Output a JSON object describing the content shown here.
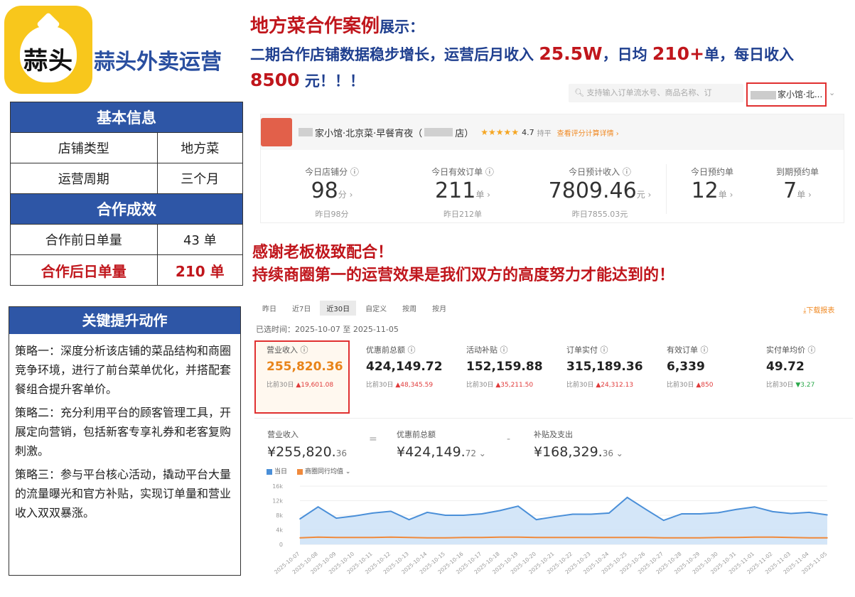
{
  "brand": {
    "logo_text": "蒜头",
    "name": "蒜头外卖运营"
  },
  "headline": {
    "title": "地方菜合作案例",
    "title_suffix": "展示：",
    "line_a": "二期合作店铺数据稳步增长，运营后月收入 ",
    "v1": "25.5W",
    "line_b": "，日均 ",
    "v2": "210+",
    "line_c": "单，每日收入 ",
    "v3": "8500",
    "line_d": " 元！！！"
  },
  "basic_info": {
    "header": "基本信息",
    "rows": [
      {
        "k": "店铺类型",
        "v": "地方菜"
      },
      {
        "k": "运营周期",
        "v": "三个月"
      }
    ],
    "result_header": "合作成效",
    "before": {
      "k": "合作前日单量",
      "v": "43 单"
    },
    "after": {
      "k": "合作后日单量",
      "v": "210 单"
    }
  },
  "key_actions": {
    "header": "关键提升动作",
    "items": [
      "策略一：深度分析该店铺的菜品结构和商圈竞争环境，进行了前台菜单优化，并搭配套餐组合提升客单价。",
      "策略二：充分利用平台的顾客管理工具，开展定向营销，包括新客专享礼券和老客复购刺激。",
      "策略三：参与平台核心活动，撬动平台大量的流量曝光和官方补贴，实现订单量和营业收入双双暴涨。"
    ]
  },
  "thanks": {
    "line1": "感谢老板极致配合！",
    "line2": "持续商圈第一的运营效果是我们双方的高度努力才能达到的！"
  },
  "screen1": {
    "search_placeholder": "支持输入订单流水号、商品名称、订",
    "store_selector": "家小馆·北...",
    "store_name": "家小馆·北京菜·早餐宵夜（",
    "store_suffix": "店）",
    "rating": "4.7",
    "rating_level": "持平",
    "rating_link": "查看评分计算详情 ›",
    "metrics": [
      {
        "label": "今日店铺分 ⓘ",
        "value": "98",
        "unit": "分 ›",
        "sub": "昨日98分"
      },
      {
        "label": "今日有效订单 ⓘ",
        "value": "211",
        "unit": "单 ›",
        "sub": "昨日212单"
      },
      {
        "label": "今日预计收入 ⓘ",
        "value": "7809.46",
        "unit": "元 ›",
        "sub": "昨日7855.03元"
      },
      {
        "label": "今日预约单",
        "value": "12",
        "unit": "单 ›",
        "sub": ""
      },
      {
        "label": "到期预约单",
        "value": "7",
        "unit": "单 ›",
        "sub": ""
      }
    ]
  },
  "screen2": {
    "tabs": [
      "昨日",
      "近7日",
      "近30日",
      "自定义",
      "按周",
      "按月"
    ],
    "download": "下载报表",
    "range": "已选时间：2025-10-07 至 2025-11-05",
    "kpis": [
      {
        "label": "营业收入 ⓘ",
        "value": "255,820.36",
        "cmp_label": "比前30日",
        "cmp": "▲19,601.08",
        "up": true
      },
      {
        "label": "优惠前总额 ⓘ",
        "value": "424,149.72",
        "cmp_label": "比前30日",
        "cmp": "▲48,345.59",
        "up": true
      },
      {
        "label": "活动补贴 ⓘ",
        "value": "152,159.88",
        "cmp_label": "比前30日",
        "cmp": "▲35,211.50",
        "up": true
      },
      {
        "label": "订单实付 ⓘ",
        "value": "315,189.36",
        "cmp_label": "比前30日",
        "cmp": "▲24,312.13",
        "up": true
      },
      {
        "label": "有效订单 ⓘ",
        "value": "6,339",
        "cmp_label": "比前30日",
        "cmp": "▲850",
        "up": true
      },
      {
        "label": "实付单均价 ⓘ",
        "value": "49.72",
        "cmp_label": "比前30日",
        "cmp": "▼3.27",
        "up": false
      }
    ],
    "revenue": {
      "label": "营业收入",
      "main": "¥255,820.",
      "dec": "36"
    },
    "eq": "=",
    "pre": {
      "label": "优惠前总额",
      "main": "¥424,149.",
      "dec": "72 ⌄"
    },
    "minus": "-",
    "sub": {
      "label": "补贴及支出",
      "main": "¥168,329.",
      "dec": "36 ⌄"
    },
    "legend": {
      "a": "当日",
      "b": "商圈同行均值 ⌄"
    }
  },
  "chart_data": {
    "type": "area",
    "x": [
      "2025-10-07",
      "2025-10-08",
      "2025-10-09",
      "2025-10-10",
      "2025-10-11",
      "2025-10-12",
      "2025-10-13",
      "2025-10-14",
      "2025-10-15",
      "2025-10-16",
      "2025-10-17",
      "2025-10-18",
      "2025-10-19",
      "2025-10-20",
      "2025-10-21",
      "2025-10-22",
      "2025-10-23",
      "2025-10-24",
      "2025-10-25",
      "2025-10-26",
      "2025-10-27",
      "2025-10-28",
      "2025-10-29",
      "2025-10-30",
      "2025-10-31",
      "2025-11-01",
      "2025-11-02",
      "2025-11-03",
      "2025-11-04",
      "2025-11-05"
    ],
    "yticks": [
      "0",
      "4k",
      "8k",
      "12k",
      "16k"
    ],
    "ylim": [
      0,
      16000
    ],
    "series": [
      {
        "name": "当日",
        "color": "#4a8fd8",
        "values": [
          7000,
          10300,
          7200,
          7800,
          8600,
          9100,
          6800,
          8800,
          8000,
          8000,
          8400,
          9300,
          10500,
          6800,
          7600,
          8300,
          8300,
          8600,
          12900,
          9700,
          6600,
          8400,
          8400,
          8700,
          9600,
          10300,
          9000,
          8500,
          8800,
          8100
        ]
      },
      {
        "name": "商圈同行均值",
        "color": "#f08a3c",
        "values": [
          1800,
          2000,
          1900,
          1900,
          1900,
          2000,
          1900,
          1800,
          1800,
          1900,
          1900,
          2000,
          2000,
          1900,
          1900,
          1900,
          1900,
          1900,
          1900,
          1900,
          1800,
          1800,
          1800,
          1900,
          1900,
          2000,
          2000,
          1900,
          1800,
          1800
        ]
      }
    ]
  },
  "colors": {
    "accent_red": "#c0161c",
    "accent_blue": "#1f3f8f",
    "header_blue": "#2e56a6",
    "logo_yellow": "#f8c71c"
  }
}
